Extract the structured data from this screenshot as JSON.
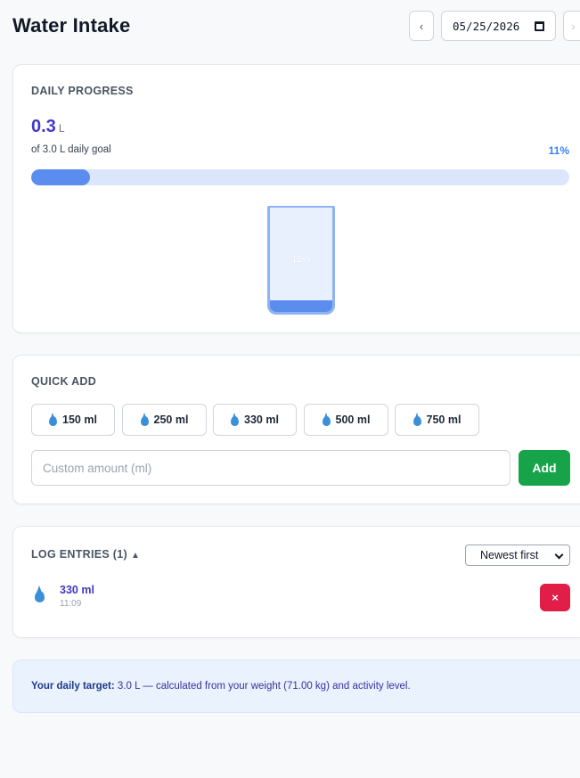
{
  "header": {
    "title": "Water Intake",
    "prev_label": "‹",
    "next_label": "›",
    "date_value": "05/25/2026"
  },
  "progress": {
    "section_label": "DAILY PROGRESS",
    "amount": "0.3",
    "unit": "L",
    "goal_text": "of 3.0 L daily goal",
    "percent_text": "11%",
    "percent_value": 11,
    "glass_percent_text": "11%"
  },
  "quick_add": {
    "section_label": "QUICK ADD",
    "amounts": [
      "150 ml",
      "250 ml",
      "330 ml",
      "500 ml",
      "750 ml"
    ],
    "custom_placeholder": "Custom amount (ml)",
    "add_label": "Add"
  },
  "log": {
    "section_label": "LOG ENTRIES (1)",
    "toggle": "▲",
    "sort_selected": "Newest first",
    "entries": [
      {
        "amount": "330 ml",
        "time": "11:09",
        "delete_label": "×"
      }
    ]
  },
  "info": {
    "label": "Your daily target:",
    "text": " 3.0 L — calculated from your weight (71.00 kg) and activity level."
  },
  "colors": {
    "accent": "#4338ca",
    "progress_fill": "#5b8dee",
    "progress_track": "#dbe6fc",
    "add_button": "#16a34a",
    "delete_button": "#e11d48",
    "drop_icon": "#3b8fd9"
  }
}
